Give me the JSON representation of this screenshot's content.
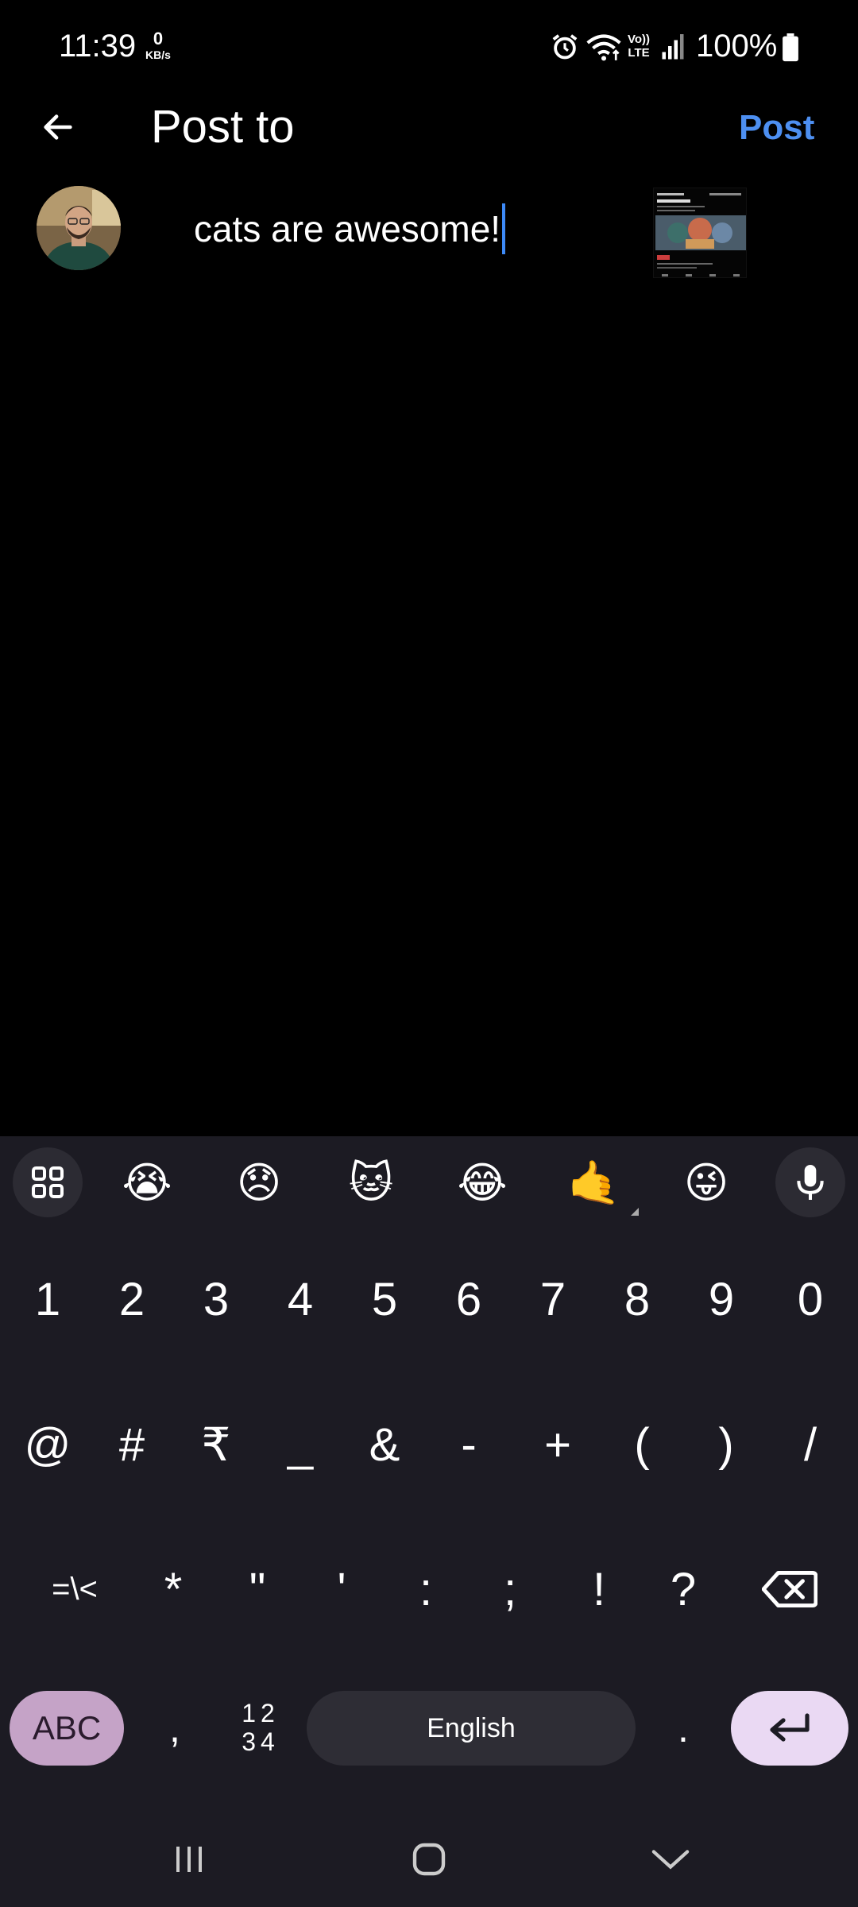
{
  "status_bar": {
    "time": "11:39",
    "net_speed_value": "0",
    "net_speed_unit": "KB/s",
    "volte_label_1": "Vo))",
    "volte_label_2": "LTE",
    "battery_percent": "100%",
    "icons": [
      "alarm-icon",
      "wifi-icon",
      "volte-icon",
      "signal-icon",
      "battery-icon"
    ]
  },
  "header": {
    "title": "Post to",
    "post_label": "Post",
    "accent_color": "#4d8ff1"
  },
  "composer": {
    "caption": "cats are awesome!",
    "caret_color": "#3d8af7"
  },
  "keyboard": {
    "suggestions": [
      "😭",
      "😞",
      "🐱",
      "😂",
      "🤙",
      "😜"
    ],
    "row1": [
      "1",
      "2",
      "3",
      "4",
      "5",
      "6",
      "7",
      "8",
      "9",
      "0"
    ],
    "row2": [
      "@",
      "#",
      "₹",
      "_",
      "&",
      "-",
      "+",
      "(",
      ")",
      "/"
    ],
    "row3": [
      "=\\<",
      "*",
      "\"",
      "'",
      ":",
      ";",
      "!",
      "?"
    ],
    "abc_label": "ABC",
    "comma_label": ",",
    "numpad_top": "12",
    "numpad_bottom": "34",
    "space_label": "English",
    "period_label": "."
  },
  "nav_bar": {
    "icons": [
      "recents-icon",
      "home-icon",
      "hide-keyboard-icon"
    ]
  }
}
